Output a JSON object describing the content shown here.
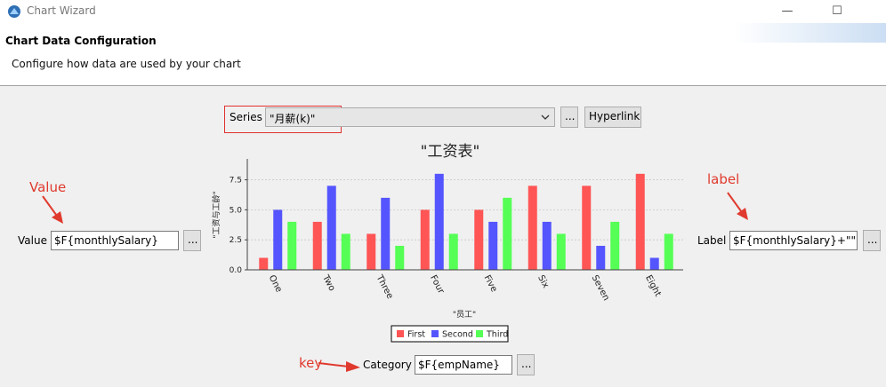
{
  "window": {
    "title": "Chart Wizard",
    "minimize_glyph": "—",
    "maximize_glyph": "☐"
  },
  "header": {
    "title": "Chart Data Configuration",
    "subtitle": "Configure how data are used by your chart"
  },
  "series": {
    "label": "Series",
    "value": "\"月薪(k)\"",
    "ellipsis_label": "...",
    "hyperlink_label": "Hyperlink"
  },
  "value_field": {
    "label": "Value",
    "value": "$F{monthlySalary}",
    "ellipsis_label": "..."
  },
  "label_field": {
    "label": "Label",
    "value": "$F{monthlySalary}+\"\"",
    "ellipsis_label": "..."
  },
  "category_field": {
    "label": "Category",
    "value": "$F{empName}",
    "ellipsis_label": "..."
  },
  "annotations": {
    "value": "Value",
    "label": "label",
    "key": "key"
  },
  "colors": {
    "annotation_red": "#e03a2e",
    "series_first": "#ff5555",
    "series_second": "#5555ff",
    "series_third": "#55ff55"
  },
  "chart_data": {
    "type": "bar",
    "title": "\"工资表\"",
    "xlabel": "\"员工\"",
    "ylabel": "\"工资与工龄\"",
    "categories": [
      "One",
      "Two",
      "Three",
      "Four",
      "Five",
      "Six",
      "Seven",
      "Eight"
    ],
    "series": [
      {
        "name": "First",
        "values": [
          1,
          4,
          3,
          5,
          5,
          7,
          7,
          8
        ]
      },
      {
        "name": "Second",
        "values": [
          5,
          7,
          6,
          8,
          4,
          4,
          2,
          1
        ]
      },
      {
        "name": "Third",
        "values": [
          4,
          3,
          2,
          3,
          6,
          3,
          4,
          3
        ]
      }
    ],
    "yticks": [
      "0.0",
      "2.5",
      "5.0",
      "7.5"
    ],
    "ylim": [
      0,
      8.8
    ],
    "grid": true,
    "legend": "bottom"
  }
}
